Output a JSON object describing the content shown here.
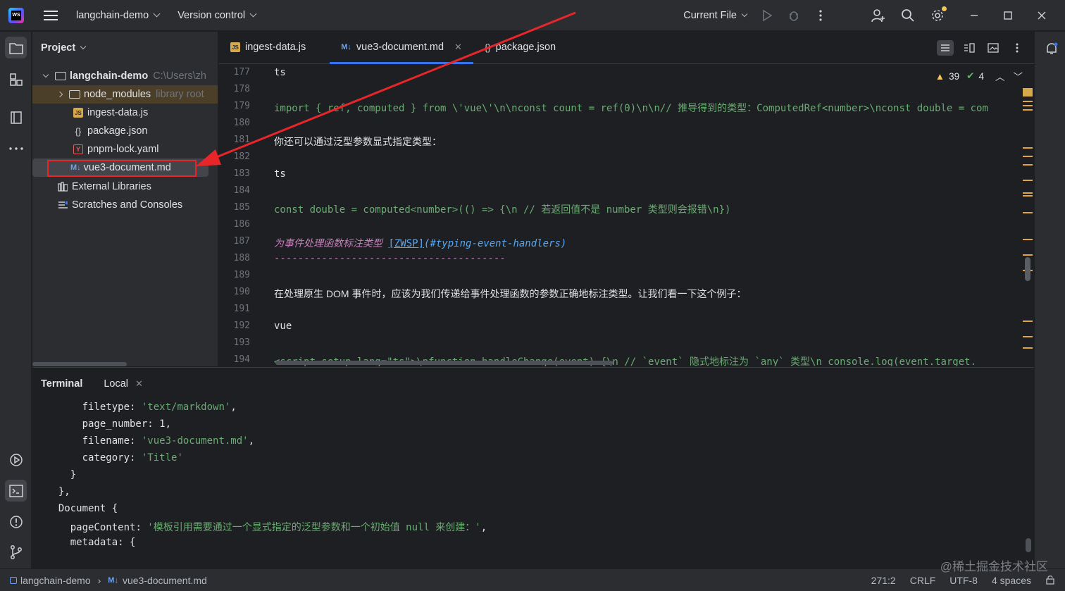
{
  "titlebar": {
    "project_name": "langchain-demo",
    "vcs_label": "Version control",
    "run_config": "Current File"
  },
  "project_panel": {
    "title": "Project",
    "root": {
      "name": "langchain-demo",
      "path": "C:\\Users\\zh"
    },
    "items": [
      {
        "label": "node_modules",
        "note": "library root",
        "type": "folder"
      },
      {
        "label": "ingest-data.js",
        "type": "js"
      },
      {
        "label": "package.json",
        "type": "json"
      },
      {
        "label": "pnpm-lock.yaml",
        "type": "yaml"
      },
      {
        "label": "vue3-document.md",
        "type": "md"
      }
    ],
    "external_libraries": "External Libraries",
    "scratches": "Scratches and Consoles"
  },
  "editor": {
    "tabs": [
      {
        "label": "ingest-data.js",
        "icon": "js-file-icon"
      },
      {
        "label": "vue3-document.md",
        "icon": "markdown-file-icon",
        "active": true
      },
      {
        "label": "package.json",
        "icon": "json-file-icon"
      }
    ],
    "inspections": {
      "warnings": "39",
      "ok": "4"
    },
    "lines": [
      {
        "num": "177",
        "text": "ts"
      },
      {
        "num": "178",
        "text": ""
      },
      {
        "num": "179",
        "text": "    import { ref, computed } from \\'vue\\'\\n\\nconst count = ref(0)\\n\\n// 推导得到的类型：ComputedRef<number>\\nconst double = com"
      },
      {
        "num": "180",
        "text": ""
      },
      {
        "num": "181",
        "text": "你还可以通过泛型参数显式指定类型："
      },
      {
        "num": "182",
        "text": ""
      },
      {
        "num": "183",
        "text": "ts"
      },
      {
        "num": "184",
        "text": ""
      },
      {
        "num": "185",
        "text": "    const double = computed<number>(() => {\\n  // 若返回值不是 number 类型则会报错\\n})"
      },
      {
        "num": "186",
        "text": ""
      },
      {
        "num": "187",
        "heading": "为事件处理函数标注类型 ",
        "box": "[ZWSP]",
        "link": "(#typing-event-handlers)"
      },
      {
        "num": "188",
        "text": "---------------------------------------"
      },
      {
        "num": "189",
        "text": ""
      },
      {
        "num": "190",
        "text": "在处理原生 DOM 事件时，应该为我们传递给事件处理函数的参数正确地标注类型。让我们看一下这个例子："
      },
      {
        "num": "191",
        "text": ""
      },
      {
        "num": "192",
        "text": "vue"
      },
      {
        "num": "193",
        "text": ""
      },
      {
        "num": "194",
        "text": "    <script setup lang=\"ts\">\\nfunction handleChange(event) {\\n  // `event` 隐式地标注为 `any` 类型\\n  console.log(event.target."
      }
    ]
  },
  "terminal": {
    "title": "Terminal",
    "tab": "Local",
    "lines": [
      {
        "indent": "      ",
        "key": "filetype",
        "value": "'text/markdown'",
        "trail": ","
      },
      {
        "indent": "      ",
        "key": "page_number",
        "value": "1",
        "trail": ",",
        "numeric": true
      },
      {
        "indent": "      ",
        "key": "filename",
        "value": "'vue3-document.md'",
        "trail": ","
      },
      {
        "indent": "      ",
        "key": "category",
        "value": "'Title'",
        "trail": ""
      },
      {
        "indent": "    ",
        "plain": "}"
      },
      {
        "indent": "  ",
        "plain": "},"
      },
      {
        "indent": "  ",
        "plain": "Document {"
      },
      {
        "indent": "    ",
        "key": "pageContent",
        "value": "'模板引用需要通过一个显式指定的泛型参数和一个初始值 null 来创建：'",
        "trail": ","
      },
      {
        "indent": "    ",
        "plain": "metadata: {"
      }
    ]
  },
  "statusbar": {
    "breadcrumb_project": "langchain-demo",
    "breadcrumb_file": "vue3-document.md",
    "position": "271:2",
    "line_sep": "CRLF",
    "encoding": "UTF-8",
    "indent": "4 spaces"
  },
  "watermark": "@稀土掘金技术社区",
  "colors": {
    "accent": "#3574f0",
    "annotation": "#e8262a",
    "string": "#6aab73",
    "warning": "#f2c55c"
  }
}
